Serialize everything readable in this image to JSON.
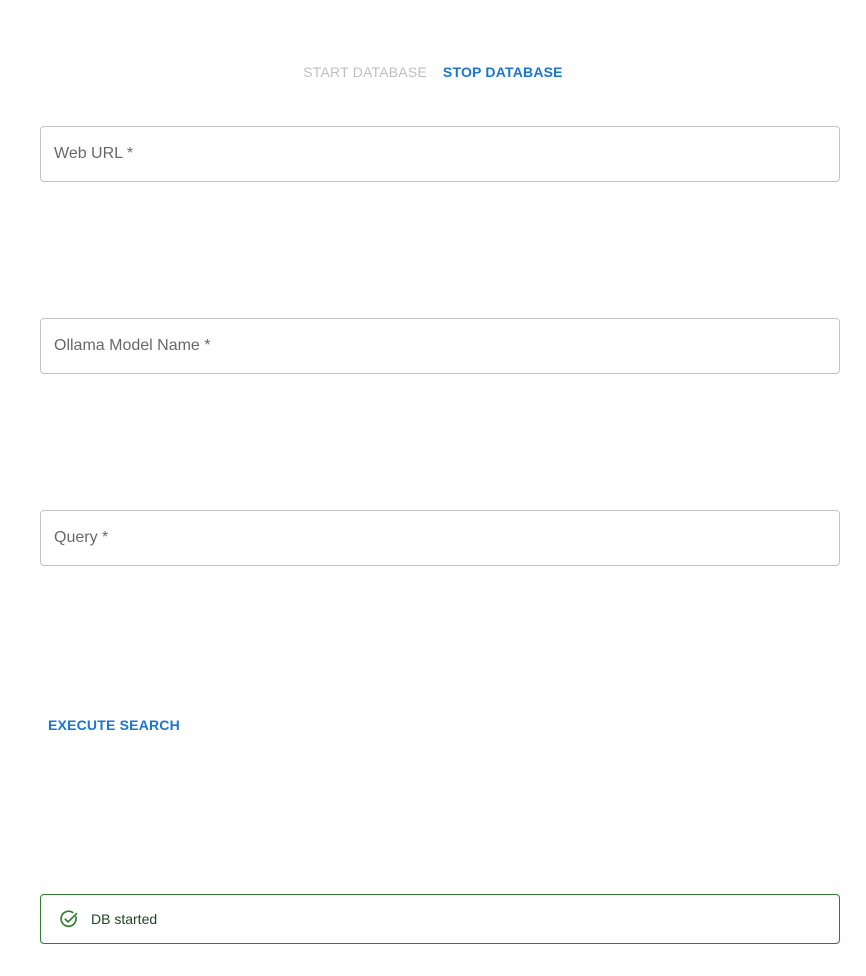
{
  "db_controls": {
    "start_label": "START DATABASE",
    "stop_label": "STOP DATABASE"
  },
  "fields": {
    "web_url": {
      "label": "Web URL *",
      "value": ""
    },
    "model": {
      "label": "Ollama Model Name *",
      "value": ""
    },
    "query": {
      "label": "Query *",
      "value": ""
    }
  },
  "actions": {
    "execute_label": "EXECUTE SEARCH"
  },
  "alert": {
    "message": "DB started",
    "icon": "check-circle-icon",
    "color": "#2e7d32"
  },
  "colors": {
    "primary": "#1976d2",
    "disabled_text": "#bdbdbd",
    "success": "#2e7d32"
  }
}
